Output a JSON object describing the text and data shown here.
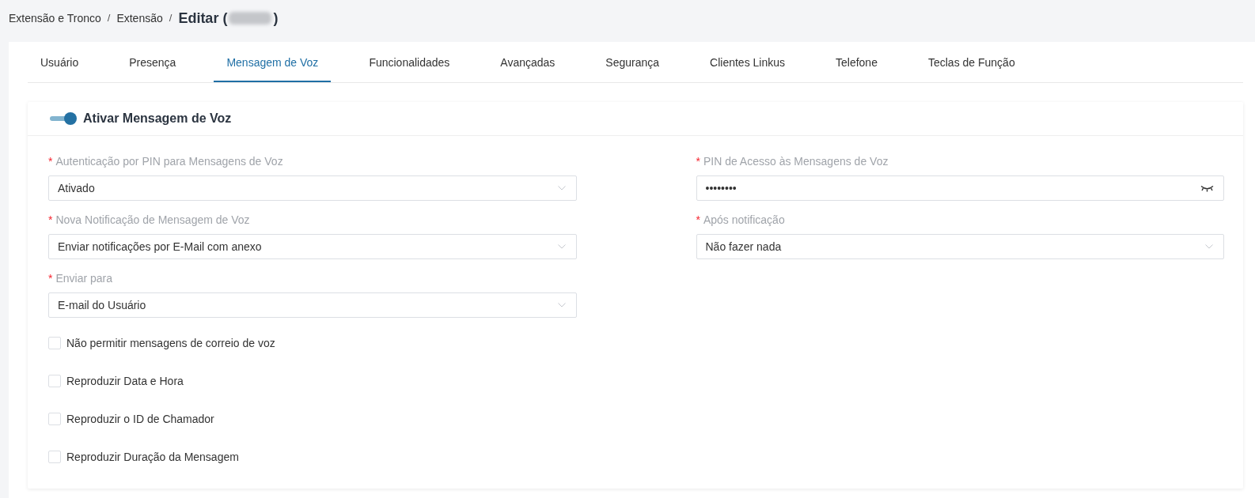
{
  "breadcrumb": {
    "items": [
      {
        "label": "Extensão e Tronco",
        "separator": "/"
      },
      {
        "label": "Extensão",
        "separator": "/"
      }
    ],
    "current": {
      "prefix": "Editar (",
      "redacted": true,
      "suffix": ")"
    }
  },
  "tabs": [
    {
      "label": "Usuário",
      "selected": false
    },
    {
      "label": "Presença",
      "selected": false
    },
    {
      "label": "Mensagem de Voz",
      "selected": true
    },
    {
      "label": "Funcionalidades",
      "selected": false
    },
    {
      "label": "Avançadas",
      "selected": false
    },
    {
      "label": "Segurança",
      "selected": false
    },
    {
      "label": "Clientes Linkus",
      "selected": false
    },
    {
      "label": "Telefone",
      "selected": false
    },
    {
      "label": "Teclas de Função",
      "selected": false
    }
  ],
  "section": {
    "title": "Ativar Mensagem de Voz",
    "enabled": true,
    "fields": [
      {
        "kind": "select",
        "required_mark": "*",
        "label": "Autenticação por PIN para Mensagens de Voz",
        "value": "Ativado"
      },
      {
        "kind": "password",
        "required_mark": "*",
        "label": "PIN de Acesso às Mensagens de Voz",
        "value": "••••••••"
      },
      {
        "kind": "select",
        "required_mark": "*",
        "label": "Nova Notificação de Mensagem de Voz",
        "value": "Enviar notificações por E-Mail com anexo"
      },
      {
        "kind": "select",
        "required_mark": "*",
        "label": "Após notificação",
        "value": "Não fazer nada"
      },
      {
        "kind": "select",
        "required_mark": "*",
        "label": "Enviar para",
        "value": "E-mail do Usuário"
      }
    ],
    "options": [
      {
        "label": "Não permitir mensagens de correio de voz",
        "checked": false
      },
      {
        "label": "Reproduzir Data e Hora",
        "checked": false
      },
      {
        "label": "Reproduzir o ID de Chamador",
        "checked": false
      },
      {
        "label": "Reproduzir Duração da Mensagem",
        "checked": false
      }
    ]
  }
}
